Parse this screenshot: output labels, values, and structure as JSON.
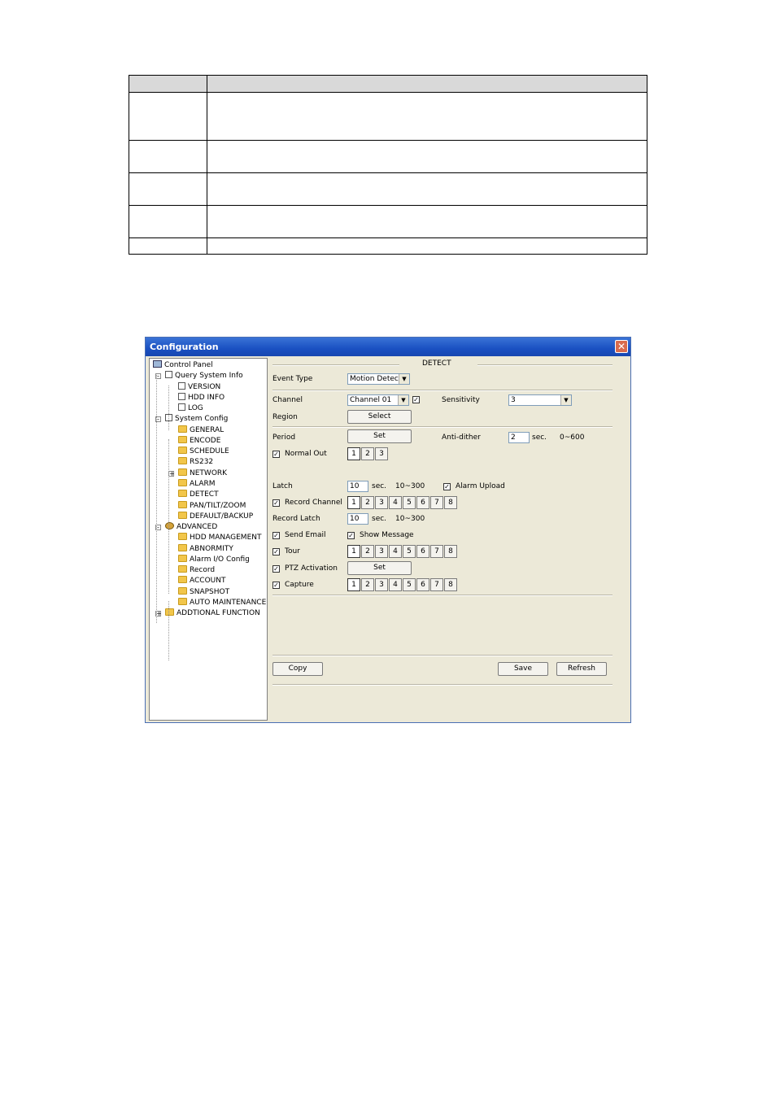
{
  "window": {
    "title": "Configuration",
    "close_glyph": "✕"
  },
  "tree": [
    {
      "label": "Control Panel",
      "icon": "computer-icon"
    },
    {
      "label": "Query System Info",
      "icon": "document-icon"
    },
    {
      "label": "VERSION",
      "icon": "document-icon"
    },
    {
      "label": "HDD INFO",
      "icon": "document-icon"
    },
    {
      "label": "LOG",
      "icon": "document-icon"
    },
    {
      "label": "System Config",
      "icon": "tools-icon"
    },
    {
      "label": "GENERAL",
      "icon": "folder-icon"
    },
    {
      "label": "ENCODE",
      "icon": "folder-icon"
    },
    {
      "label": "SCHEDULE",
      "icon": "folder-icon"
    },
    {
      "label": "RS232",
      "icon": "folder-icon"
    },
    {
      "label": "NETWORK",
      "icon": "folder-icon"
    },
    {
      "label": "ALARM",
      "icon": "folder-icon"
    },
    {
      "label": "DETECT",
      "icon": "folder-open-icon"
    },
    {
      "label": "PAN/TILT/ZOOM",
      "icon": "folder-icon"
    },
    {
      "label": "DEFAULT/BACKUP",
      "icon": "folder-icon"
    },
    {
      "label": "ADVANCED",
      "icon": "gear-icon"
    },
    {
      "label": "HDD MANAGEMENT",
      "icon": "folder-icon"
    },
    {
      "label": "ABNORMITY",
      "icon": "folder-icon"
    },
    {
      "label": "Alarm I/O Config",
      "icon": "folder-icon"
    },
    {
      "label": "Record",
      "icon": "folder-icon"
    },
    {
      "label": "ACCOUNT",
      "icon": "folder-icon"
    },
    {
      "label": "SNAPSHOT",
      "icon": "folder-icon"
    },
    {
      "label": "AUTO MAINTENANCE",
      "icon": "folder-icon"
    },
    {
      "label": "ADDTIONAL FUNCTION",
      "icon": "folder-icon"
    }
  ],
  "detect": {
    "section_title": "DETECT",
    "event_type_label": "Event Type",
    "event_type_value": "Motion Detect",
    "channel_label": "Channel",
    "channel_value": "Channel 01",
    "channel_checked": "✓",
    "sensitivity_label": "Sensitivity",
    "sensitivity_value": "3",
    "region_label": "Region",
    "region_button": "Select",
    "period_label": "Period",
    "period_button": "Set",
    "antidither_label": "Anti-dither",
    "antidither_value": "2",
    "antidither_unit": "sec.",
    "antidither_range": "0~600",
    "normal_out_label": "Normal Out",
    "normal_out_checked": "✓",
    "latch_label": "Latch",
    "latch_value": "10",
    "latch_unit": "sec.",
    "latch_range": "10~300",
    "alarm_upload_label": "Alarm Upload",
    "alarm_upload_checked": "✓",
    "record_channel_label": "Record Channel",
    "record_channel_checked": "✓",
    "record_latch_label": "Record Latch",
    "record_latch_value": "10",
    "record_latch_unit": "sec.",
    "record_latch_range": "10~300",
    "send_email_label": "Send Email",
    "send_email_checked": "✓",
    "show_message_label": "Show Message",
    "show_message_checked": "✓",
    "tour_label": "Tour",
    "tour_checked": "✓",
    "ptz_label": "PTZ Activation",
    "ptz_checked": "✓",
    "ptz_button": "Set",
    "capture_label": "Capture",
    "capture_checked": "✓",
    "dropdown_arrow": "▼",
    "normal_out_channels": [
      "1",
      "2",
      "3"
    ],
    "channels": [
      "1",
      "2",
      "3",
      "4",
      "5",
      "6",
      "7",
      "8"
    ],
    "copy_button": "Copy",
    "save_button": "Save",
    "refresh_button": "Refresh"
  }
}
